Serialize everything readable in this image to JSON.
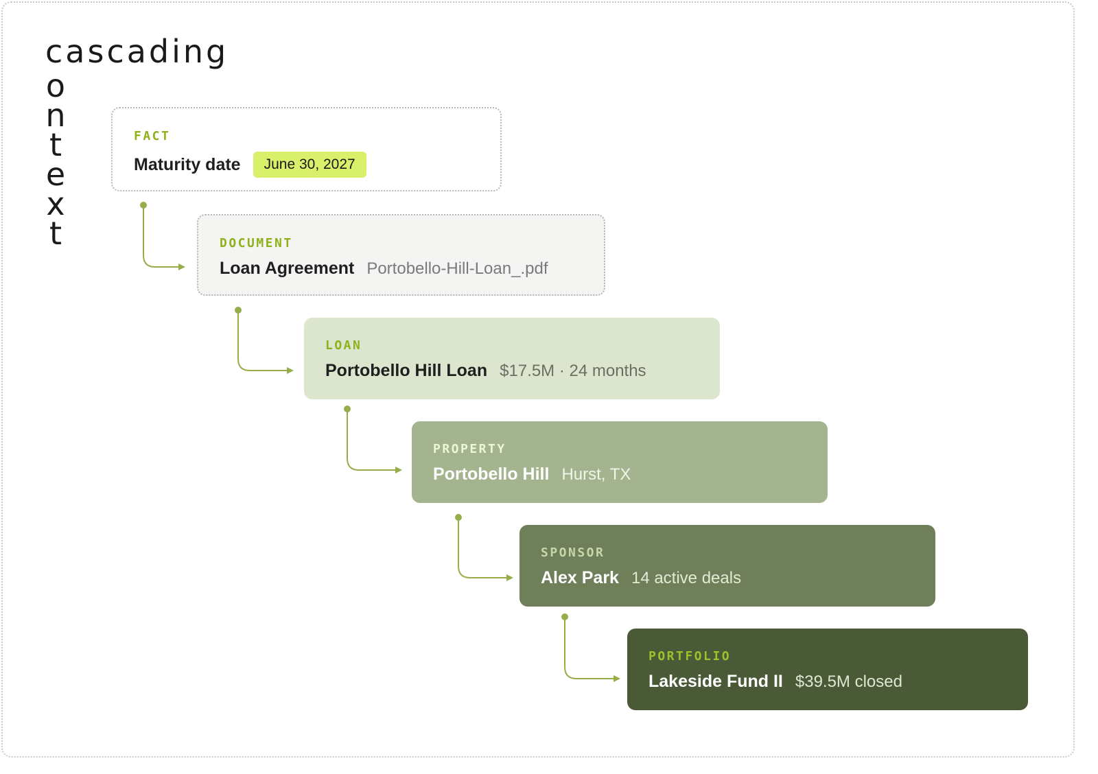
{
  "title": {
    "horizontal": "cascading",
    "vertical_letters": [
      "o",
      "n",
      "t",
      "e",
      "x",
      "t"
    ]
  },
  "cards": [
    {
      "kind": "FACT",
      "name": "Maturity date",
      "value": "June 30, 2027"
    },
    {
      "kind": "DOCUMENT",
      "name": "Loan Agreement",
      "meta": "Portobello-Hill-Loan_.pdf"
    },
    {
      "kind": "LOAN",
      "name": "Portobello Hill Loan",
      "meta": "$17.5M · 24 months"
    },
    {
      "kind": "PROPERTY",
      "name": "Portobello Hill",
      "meta": "Hurst, TX"
    },
    {
      "kind": "SPONSOR",
      "name": "Alex Park",
      "meta": "14 active deals"
    },
    {
      "kind": "PORTFOLIO",
      "name": "Lakeside Fund II",
      "meta": "$39.5M closed"
    }
  ],
  "colors": {
    "accent": "#8fb11a",
    "highlight": "#d9f06a",
    "connector": "#97ad4a",
    "loan_bg": "#dce6cf",
    "property_bg": "#a3b48f",
    "sponsor_bg": "#6f7f5a",
    "portfolio_bg": "#4a5a37"
  }
}
